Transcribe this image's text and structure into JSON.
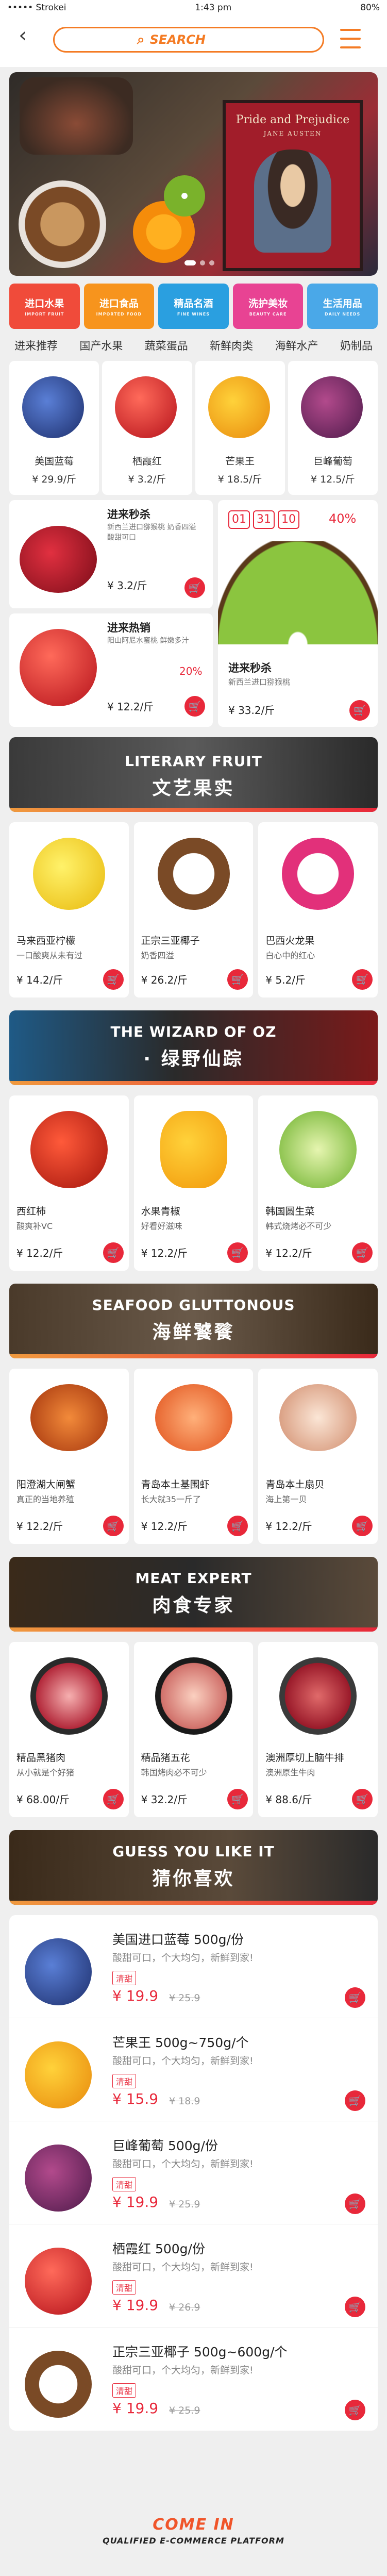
{
  "status_bar": {
    "carrier": "••••• Strokei",
    "time": "1:43 pm",
    "battery": "80%"
  },
  "header": {
    "search_placeholder": "SEARCH"
  },
  "banner": {
    "book_title": "Pride and Prejudice",
    "book_author": "JANE AUSTEN"
  },
  "categories": [
    {
      "label": "进口水果",
      "sub": "IMPORT FRUIT",
      "color": "#f04b3a"
    },
    {
      "label": "进口食品",
      "sub": "IMPORTED FOOD",
      "color": "#f7941d"
    },
    {
      "label": "精品名酒",
      "sub": "FINE WINES",
      "color": "#2a9fe0"
    },
    {
      "label": "洗护美妆",
      "sub": "BEAUTY CARE",
      "color": "#e84393"
    },
    {
      "label": "生活用品",
      "sub": "DAILY NEEDS",
      "color": "#4aa8e8"
    }
  ],
  "cat_tabs": [
    "进来推荐",
    "国产水果",
    "蔬菜蛋品",
    "新鲜肉类",
    "海鲜水产",
    "奶制品"
  ],
  "featured": [
    {
      "name": "美国蓝莓",
      "price": "¥ 29.9/斤"
    },
    {
      "name": "栖霞红",
      "price": "¥ 3.2/斤"
    },
    {
      "name": "芒果王",
      "price": "¥ 18.5/斤"
    },
    {
      "name": "巨峰葡萄",
      "price": "¥ 12.5/斤"
    }
  ],
  "flash_sale": {
    "title": "进来秒杀",
    "desc": "新西兰进口猕猴桃 奶香四溢 酸甜可口",
    "price": "¥ 3.2/斤",
    "countdown": [
      "01",
      "31",
      "10"
    ],
    "discount": "40%",
    "hot_title": "进来热销",
    "hot_desc": "阳山阿尼水蜜桃 鲜嫩多汁",
    "hot_discount": "20%",
    "hot_price": "¥ 12.2/斤",
    "big_title": "进来秒杀",
    "big_desc": "新西兰进口猕猴桃",
    "big_price": "¥ 33.2/斤"
  },
  "sections": [
    {
      "en": "LITERARY FRUIT",
      "cn": "文艺果实",
      "items": [
        {
          "name": "马来西亚柠檬",
          "desc": "一口酸爽从未有过",
          "price": "¥ 14.2/斤"
        },
        {
          "name": "正宗三亚椰子",
          "desc": "奶香四溢",
          "price": "¥ 26.2/斤"
        },
        {
          "name": "巴西火龙果",
          "desc": "白心中的红心",
          "price": "¥ 5.2/斤"
        }
      ]
    },
    {
      "en": "THE WIZARD OF OZ",
      "cn": "· 绿野仙踪",
      "items": [
        {
          "name": "西红柿",
          "desc": "酸爽补VC",
          "price": "¥ 12.2/斤"
        },
        {
          "name": "水果青椒",
          "desc": "好看好滋味",
          "price": "¥ 12.2/斤"
        },
        {
          "name": "韩国圆生菜",
          "desc": "韩式烧烤必不可少",
          "price": "¥ 12.2/斤"
        }
      ]
    },
    {
      "en": "SEAFOOD GLUTTONOUS",
      "cn": "海鲜饕餮",
      "items": [
        {
          "name": "阳澄湖大闸蟹",
          "desc": "真正的当地养殖",
          "price": "¥ 12.2/斤"
        },
        {
          "name": "青岛本土基围虾",
          "desc": "长大就35一斤了",
          "price": "¥ 12.2/斤"
        },
        {
          "name": "青岛本土扇贝",
          "desc": "海上第一贝",
          "price": "¥ 12.2/斤"
        }
      ]
    },
    {
      "en": "MEAT EXPERT",
      "cn": "肉食专家",
      "items": [
        {
          "name": "精品黑猪肉",
          "desc": "从小就是个好猪",
          "price": "¥ 68.00/斤"
        },
        {
          "name": "精品猪五花",
          "desc": "韩国烤肉必不可少",
          "price": "¥ 32.2/斤"
        },
        {
          "name": "澳洲厚切上脑牛排",
          "desc": "澳洲原生牛肉",
          "price": "¥ 88.6/斤"
        }
      ]
    }
  ],
  "guess": {
    "en": "GUESS YOU LIKE IT",
    "cn": "猜你喜欢",
    "items": [
      {
        "name": "美国进口蓝莓 500g/份",
        "desc": "酸甜可口，个大均匀，新鲜到家!",
        "tag": "清甜",
        "price": "¥ 19.9",
        "old": "¥ 25.9"
      },
      {
        "name": "芒果王 500g~750g/个",
        "desc": "酸甜可口，个大均匀，新鲜到家!",
        "tag": "清甜",
        "price": "¥ 15.9",
        "old": "¥ 18.9"
      },
      {
        "name": "巨峰葡萄 500g/份",
        "desc": "酸甜可口，个大均匀，新鲜到家!",
        "tag": "清甜",
        "price": "¥ 19.9",
        "old": "¥ 25.9"
      },
      {
        "name": "栖霞红 500g/份",
        "desc": "酸甜可口，个大均匀，新鲜到家!",
        "tag": "清甜",
        "price": "¥ 19.9",
        "old": "¥ 26.9"
      },
      {
        "name": "正宗三亚椰子 500g~600g/个",
        "desc": "酸甜可口，个大均匀，新鲜到家!",
        "tag": "清甜",
        "price": "¥ 19.9",
        "old": "¥ 25.9"
      }
    ]
  },
  "footer": {
    "title": "COME IN",
    "subtitle": "QUALIFIED E-COMMERCE PLATFORM"
  }
}
